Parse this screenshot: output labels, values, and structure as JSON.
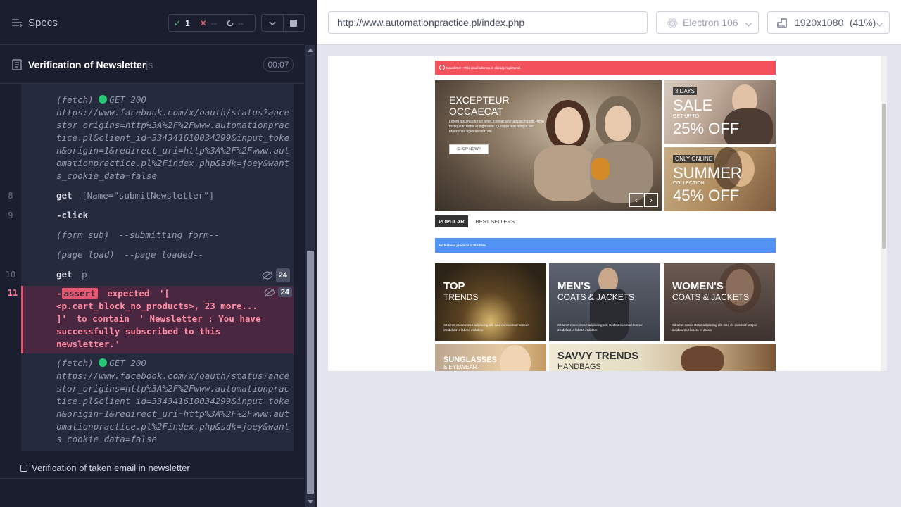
{
  "reporter": {
    "specs_label": "Specs",
    "stats": {
      "passed": "1",
      "failed": "--",
      "pending": "--"
    },
    "test": {
      "title": "Verification of Newsletter",
      "ext": "js",
      "duration": "00:07"
    },
    "commands": [
      {
        "type": "fetch",
        "label": "(fetch)",
        "method": "GET 200",
        "url": "https://www.facebook.com/x/oauth/status?ancestor_origins=http%3A%2F%2Fwww.automationpractice.pl&client_id=334341610034299&input_token&origin=1&redirect_uri=http%3A%2F%2Fwww.automationpractice.pl%2Findex.php&sdk=joey&wants_cookie_data=false"
      },
      {
        "num": "8",
        "name": "get",
        "message": "[Name=\"submitNewsletter\"]"
      },
      {
        "num": "9",
        "name": "-click",
        "message": ""
      },
      {
        "type": "event",
        "label": "(form sub)",
        "message": "--submitting form--"
      },
      {
        "type": "event",
        "label": "(page load)",
        "message": "--page loaded--"
      },
      {
        "num": "10",
        "name": "get",
        "message": "p",
        "count": "24"
      }
    ],
    "failed_command": {
      "num": "11",
      "dash": "-",
      "tag": "assert",
      "text_1": "expected",
      "text_2": "'[",
      "text_3": "<p.cart_block_no_products>, 23 more...",
      "text_4": "]'",
      "text_5": "to contain",
      "text_6": "' Newsletter : You have successfully subscribed to this newsletter.'",
      "count": "24"
    },
    "fetch_2": {
      "label": "(fetch)",
      "method": "GET 200",
      "url": "https://www.facebook.com/x/oauth/status?ancestor_origins=http%3A%2F%2Fwww.automationpractice.pl&client_id=334341610034299&input_token&origin=1&redirect_uri=http%3A%2F%2Fwww.automationpractice.pl%2Findex.php&sdk=joey&wants_cookie_data=false"
    },
    "next_test": "Verification of taken email in newsletter"
  },
  "aut": {
    "url": "http://www.automationpractice.pl/index.php",
    "browser": "Electron 106",
    "viewport": "1920x1080",
    "scale": "(41%)"
  },
  "site": {
    "alert": "Newsletter : This email address is already registered.",
    "hero": {
      "title_1": "EXCEPTEUR",
      "title_2": "OCCAECAT",
      "text": "Lorem ipsum dolor sit amet, consectetur adipiscing elit. Proin tristique in tortor et dignissim. Quisque non tempor leo. Maecenas egestas sem elit",
      "button": "SHOP NOW !"
    },
    "promo_sale": {
      "tag": "3 DAYS",
      "big": "SALE",
      "small": "GET UP TO",
      "big2": "25% OFF"
    },
    "promo_summer": {
      "tag": "ONLY ONLINE",
      "big": "SUMMER",
      "small": "COLLECTION",
      "big2": "45% OFF"
    },
    "tabs": {
      "popular": "POPULAR",
      "best": "BEST SELLERS"
    },
    "no_featured": "No featured products at this time.",
    "banners": {
      "top": {
        "h1": "TOP",
        "h2": "TRENDS",
        "desc": "Sit amet conse ctetur adipiscing elit. Sed do eiusmod tempor incididunt ut labore et dolore"
      },
      "men": {
        "h1": "MEN'S",
        "h2": "COATS & JACKETS",
        "desc": "Sit amet conse ctetur adipiscing elit. Sed do eiusmod tempor incididunt ut labore et dolore"
      },
      "women": {
        "h1": "WOMEN'S",
        "h2": "COATS & JACKETS",
        "desc": "Sit amet conse ctetur adipiscing elit. Sed do eiusmod tempor incididunt ut labore et dolore"
      },
      "sun": {
        "h1": "SUNGLASSES",
        "h2": "& EYEWEAR"
      },
      "savvy": {
        "h1": "SAVVY TRENDS",
        "h2": "HANDBAGS"
      }
    }
  }
}
